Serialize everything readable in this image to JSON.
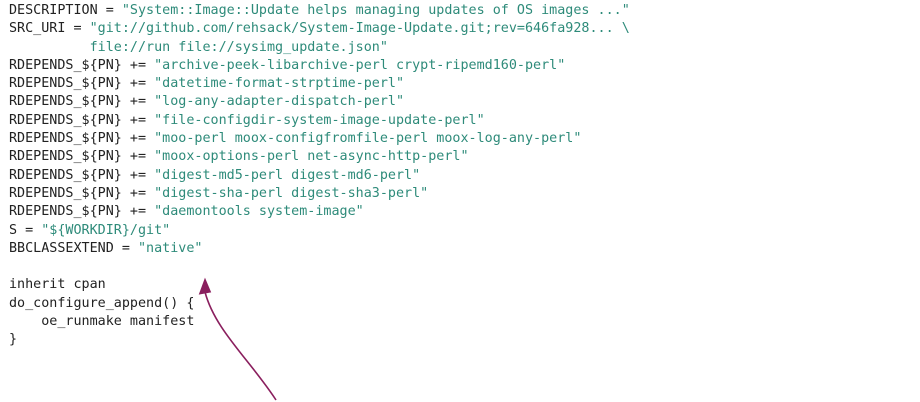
{
  "colors": {
    "text": "#222222",
    "string": "#2e8b7a",
    "arrow": "#8a1f5e",
    "background": "#ffffff"
  },
  "code": {
    "lines": [
      {
        "pre": "DESCRIPTION = ",
        "str": "\"System::Image::Update helps managing updates of OS images ...\"",
        "post": ""
      },
      {
        "pre": "SRC_URI = ",
        "str": "\"git://github.com/rehsack/System-Image-Update.git;rev=646fa928... \\",
        "post": ""
      },
      {
        "pre": "          ",
        "str": "file://run file://sysimg_update.json\"",
        "post": ""
      },
      {
        "pre": "RDEPENDS_${PN} += ",
        "str": "\"archive-peek-libarchive-perl crypt-ripemd160-perl\"",
        "post": ""
      },
      {
        "pre": "RDEPENDS_${PN} += ",
        "str": "\"datetime-format-strptime-perl\"",
        "post": ""
      },
      {
        "pre": "RDEPENDS_${PN} += ",
        "str": "\"log-any-adapter-dispatch-perl\"",
        "post": ""
      },
      {
        "pre": "RDEPENDS_${PN} += ",
        "str": "\"file-configdir-system-image-update-perl\"",
        "post": ""
      },
      {
        "pre": "RDEPENDS_${PN} += ",
        "str": "\"moo-perl moox-configfromfile-perl moox-log-any-perl\"",
        "post": ""
      },
      {
        "pre": "RDEPENDS_${PN} += ",
        "str": "\"moox-options-perl net-async-http-perl\"",
        "post": ""
      },
      {
        "pre": "RDEPENDS_${PN} += ",
        "str": "\"digest-md5-perl digest-md6-perl\"",
        "post": ""
      },
      {
        "pre": "RDEPENDS_${PN} += ",
        "str": "\"digest-sha-perl digest-sha3-perl\"",
        "post": ""
      },
      {
        "pre": "RDEPENDS_${PN} += ",
        "str": "\"daemontools system-image\"",
        "post": ""
      },
      {
        "pre": "S = ",
        "str": "\"${WORKDIR}/git\"",
        "post": ""
      },
      {
        "pre": "BBCLASSEXTEND = ",
        "str": "\"native\"",
        "post": ""
      },
      {
        "pre": "",
        "str": "",
        "post": ""
      },
      {
        "pre": "inherit cpan",
        "str": "",
        "post": ""
      },
      {
        "pre": "do_configure_append() {",
        "str": "",
        "post": ""
      },
      {
        "pre": "    oe_runmake manifest",
        "str": "",
        "post": ""
      },
      {
        "pre": "}",
        "str": "",
        "post": ""
      }
    ]
  }
}
